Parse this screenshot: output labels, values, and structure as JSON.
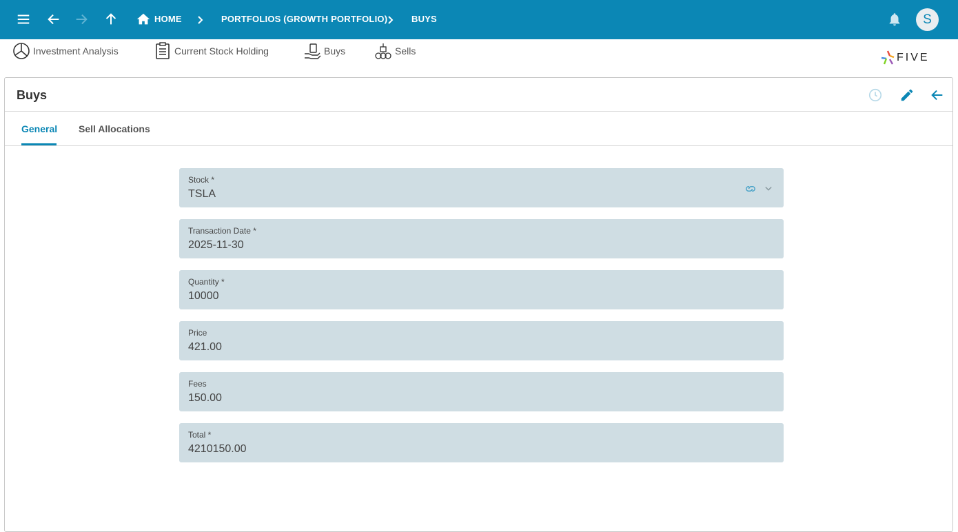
{
  "appbar": {
    "breadcrumbs": [
      {
        "label": "HOME"
      },
      {
        "label": "PORTFOLIOS (GROWTH PORTFOLIO)"
      },
      {
        "label": "BUYS"
      }
    ],
    "avatar_initial": "S",
    "bg_color": "#0b87b5"
  },
  "menu": {
    "items": [
      {
        "label": "Investment Analysis",
        "icon": "pie-chart-icon"
      },
      {
        "label": "Current Stock Holding",
        "icon": "clipboard-list-icon"
      },
      {
        "label": "Buys",
        "icon": "hand-money-icon"
      },
      {
        "label": "Sells",
        "icon": "coins-icon"
      }
    ],
    "logo_text": "FIVE"
  },
  "card": {
    "title": "Buys",
    "tabs": [
      {
        "label": "General",
        "active": true
      },
      {
        "label": "Sell Allocations",
        "active": false
      }
    ]
  },
  "form": {
    "fields": [
      {
        "label": "Stock *",
        "value": "TSLA"
      },
      {
        "label": "Transaction Date *",
        "value": "2025-11-30"
      },
      {
        "label": "Quantity *",
        "value": "10000"
      },
      {
        "label": "Price",
        "value": "421.00"
      },
      {
        "label": "Fees",
        "value": "150.00"
      },
      {
        "label": "Total *",
        "value": "4210150.00"
      }
    ]
  }
}
